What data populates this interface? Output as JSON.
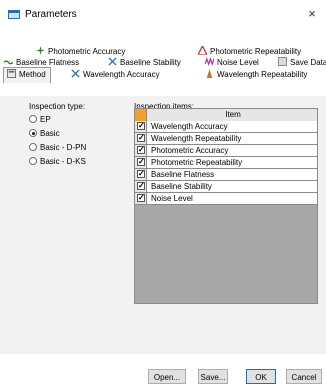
{
  "window": {
    "title": "Parameters",
    "close_glyph": "×"
  },
  "tabs": [
    {
      "label": "Photometric Accuracy",
      "icon": "photometric-accuracy-icon"
    },
    {
      "label": "Photometric Repeatability",
      "icon": "photometric-repeatability-icon"
    },
    {
      "label": "Baseline Flatness",
      "icon": "baseline-flatness-icon"
    },
    {
      "label": "Baseline Stability",
      "icon": "baseline-stability-icon"
    },
    {
      "label": "Noise Level",
      "icon": "noise-level-icon"
    },
    {
      "label": "Save Data",
      "icon": "save-data-icon"
    },
    {
      "label": "Method",
      "icon": "method-icon",
      "active": true
    },
    {
      "label": "Wavelength Accuracy",
      "icon": "wavelength-accuracy-icon"
    },
    {
      "label": "Wavelength Repeatability",
      "icon": "wavelength-repeatability-icon"
    }
  ],
  "inspection_type": {
    "label": "Inspection type:",
    "options": [
      {
        "label": "EP",
        "checked": false
      },
      {
        "label": "Basic",
        "checked": true
      },
      {
        "label": "Basic - D-PN",
        "checked": false
      },
      {
        "label": "Basic - D-KS",
        "checked": false
      }
    ]
  },
  "inspection_items": {
    "label": "Inspection items:",
    "column_header": "Item",
    "rows": [
      {
        "item": "Wavelength Accuracy",
        "checked": true
      },
      {
        "item": "Wavelength Repeatability",
        "checked": true
      },
      {
        "item": "Photometric Accuracy",
        "checked": true
      },
      {
        "item": "Photometric Repeatability",
        "checked": true
      },
      {
        "item": "Baseline Flatness",
        "checked": true
      },
      {
        "item": "Baseline Stability",
        "checked": true
      },
      {
        "item": "Noise Level",
        "checked": true
      }
    ]
  },
  "buttons": {
    "open": "Open...",
    "save": "Save...",
    "ok": "OK",
    "cancel": "Cancel"
  },
  "colors": {
    "accent": "#0078d7",
    "corner": "#f0a22e"
  }
}
